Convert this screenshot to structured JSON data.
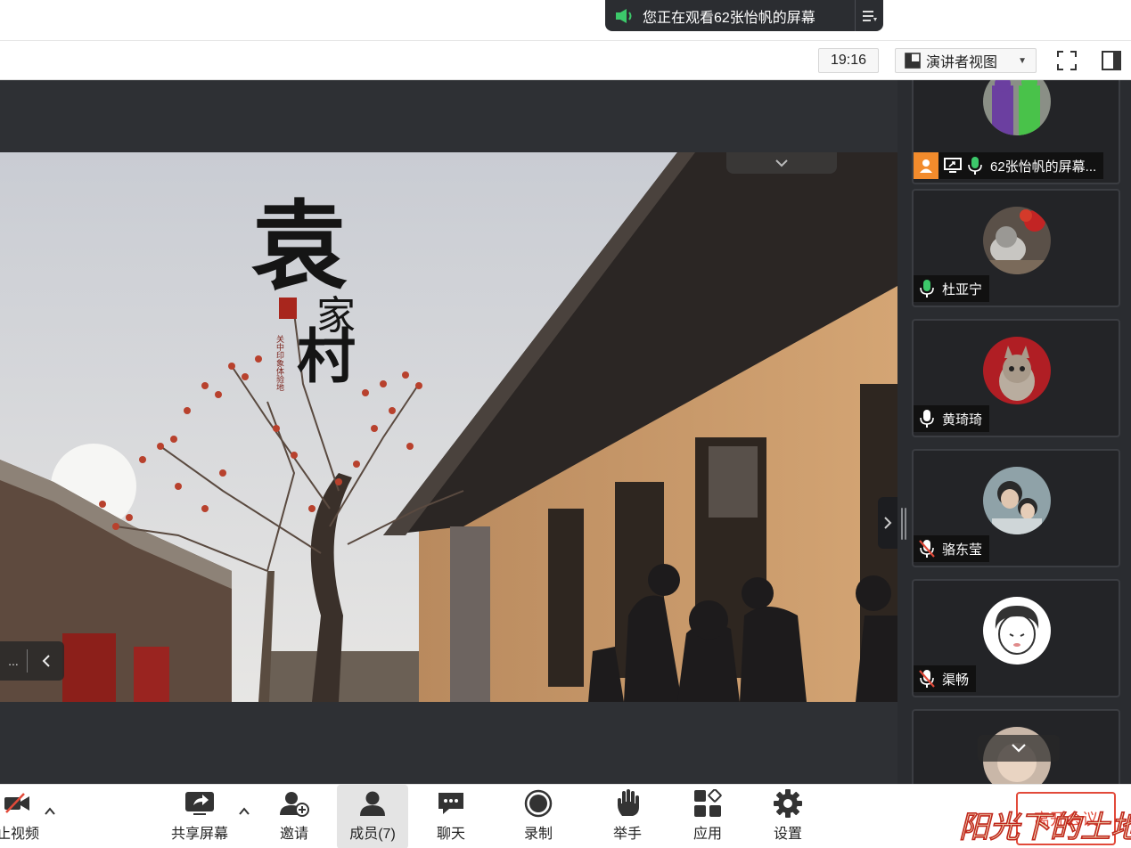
{
  "share_banner": {
    "text": "您正在观看62张怡帆的屏幕"
  },
  "toolbar": {
    "clock": "19:16",
    "view_label": "演讲者视图"
  },
  "slide": {
    "title_big": "袁",
    "title_small": "家",
    "title_big2": "村",
    "seal": "关中印象体验地"
  },
  "left_pager": {
    "dots": "..."
  },
  "participants": [
    {
      "name": "62张怡帆的屏幕...",
      "mic": "on-green",
      "host": true,
      "sharing": true,
      "avatar": "costume-kids"
    },
    {
      "name": "杜亚宁",
      "mic": "on-green",
      "avatar": "cat-flowers"
    },
    {
      "name": "黄琦琦",
      "mic": "on-white",
      "avatar": "kitten-red"
    },
    {
      "name": "骆东莹",
      "mic": "muted",
      "avatar": "couple-photo"
    },
    {
      "name": "渠畅",
      "mic": "muted",
      "avatar": "cartoon-face"
    },
    {
      "name": "",
      "mic": "",
      "avatar": "partial"
    }
  ],
  "bottombar": {
    "video_label": "止视频",
    "share_label": "共享屏幕",
    "invite_label": "邀请",
    "members_label": "成员(7)",
    "chat_label": "聊天",
    "record_label": "录制",
    "raise_label": "举手",
    "apps_label": "应用",
    "settings_label": "设置",
    "leave_label": "离开会议"
  },
  "watermark": "阳光下的土地",
  "colors": {
    "accent_orange": "#f28b2c",
    "leave_red": "#e24a3a",
    "mic_green": "#3cc86a",
    "banner_dark": "#2b2d31"
  }
}
